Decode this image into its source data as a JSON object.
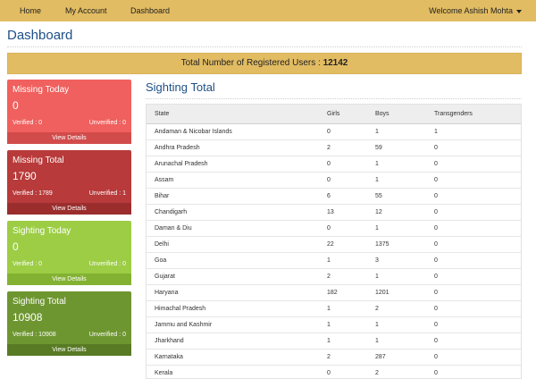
{
  "nav": {
    "items": [
      "Home",
      "My Account",
      "Dashboard"
    ],
    "welcome": "Welcome Ashish Mohta"
  },
  "page_title": "Dashboard",
  "registered": {
    "label": "Total Number of Registered Users :",
    "value": "12142"
  },
  "cards": [
    {
      "title": "Missing Today",
      "count": "0",
      "verified": "Verified : 0",
      "unverified": "Unverified : 0",
      "footer": "View Details"
    },
    {
      "title": "Missing Total",
      "count": "1790",
      "verified": "Verified : 1789",
      "unverified": "Unverified : 1",
      "footer": "View Details"
    },
    {
      "title": "Sighting Today",
      "count": "0",
      "verified": "Verified : 0",
      "unverified": "Unverified : 0",
      "footer": "View Details"
    },
    {
      "title": "Sighting Total",
      "count": "10908",
      "verified": "Verified : 10908",
      "unverified": "Unverified : 0",
      "footer": "View Details"
    }
  ],
  "table": {
    "title": "Sighting Total",
    "headers": [
      "State",
      "Girls",
      "Boys",
      "Transgenders"
    ],
    "rows": [
      [
        "Andaman & Nicobar Islands",
        "0",
        "1",
        "1"
      ],
      [
        "Andhra Pradesh",
        "2",
        "59",
        "0"
      ],
      [
        "Arunachal Pradesh",
        "0",
        "1",
        "0"
      ],
      [
        "Assam",
        "0",
        "1",
        "0"
      ],
      [
        "Bihar",
        "6",
        "55",
        "0"
      ],
      [
        "Chandigarh",
        "13",
        "12",
        "0"
      ],
      [
        "Daman & Diu",
        "0",
        "1",
        "0"
      ],
      [
        "Delhi",
        "22",
        "1375",
        "0"
      ],
      [
        "Goa",
        "1",
        "3",
        "0"
      ],
      [
        "Gujarat",
        "2",
        "1",
        "0"
      ],
      [
        "Haryana",
        "182",
        "1201",
        "0"
      ],
      [
        "Himachal Pradesh",
        "1",
        "2",
        "0"
      ],
      [
        "Jammu and Kashmir",
        "1",
        "1",
        "0"
      ],
      [
        "Jharkhand",
        "1",
        "1",
        "0"
      ],
      [
        "Karnataka",
        "2",
        "287",
        "0"
      ],
      [
        "Kerala",
        "0",
        "2",
        "0"
      ]
    ]
  }
}
